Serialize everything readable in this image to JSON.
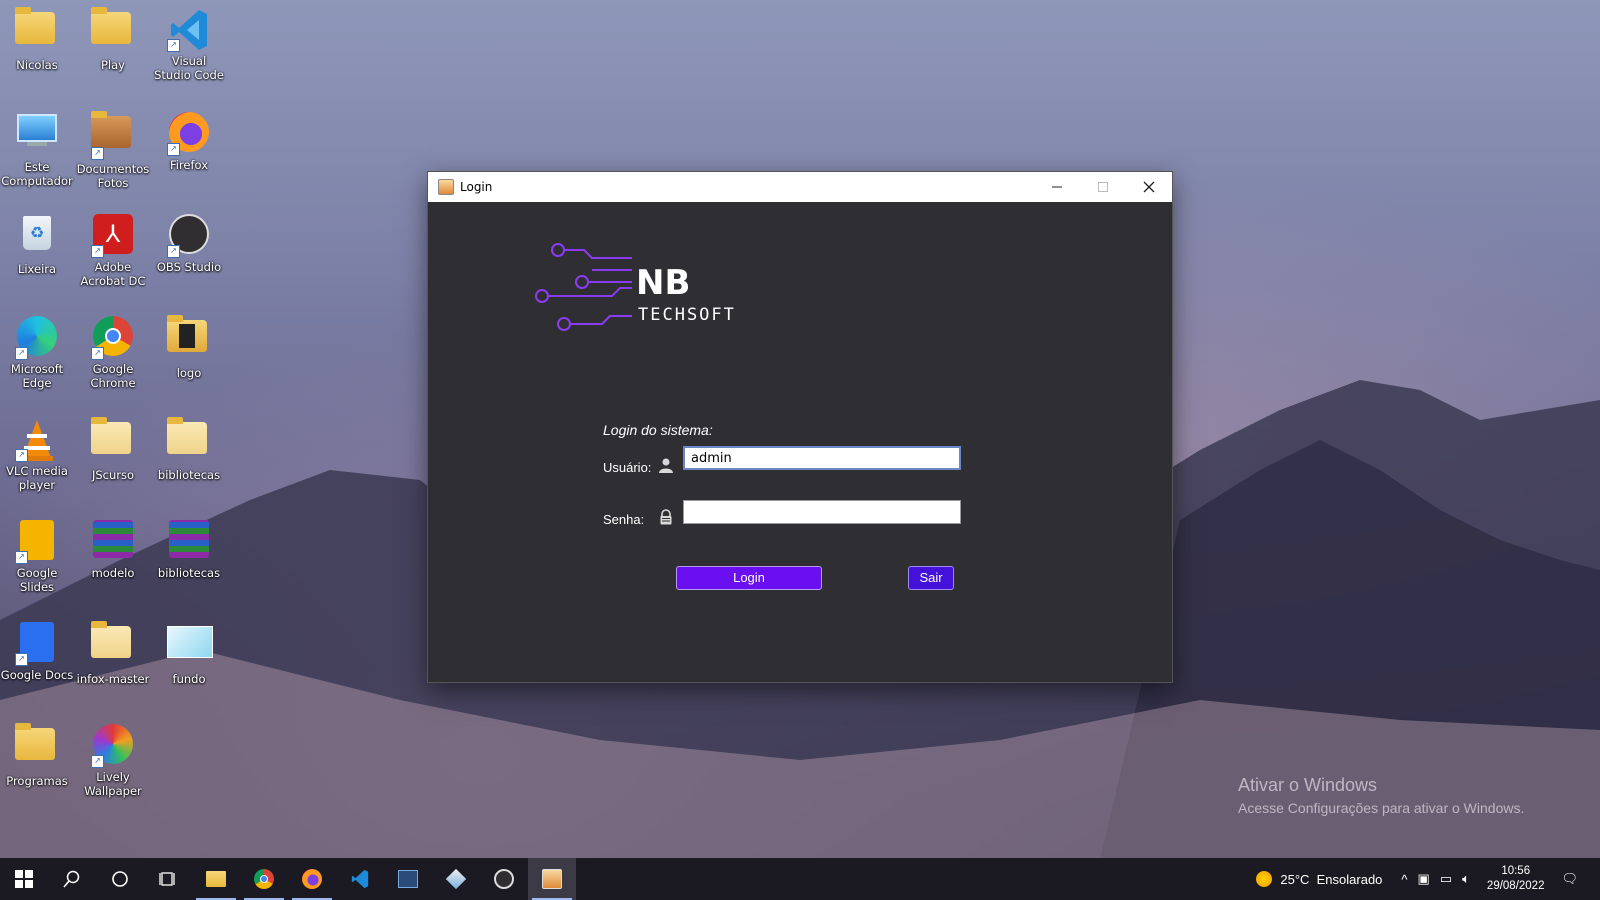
{
  "desktop": {
    "icons": [
      {
        "label": "Nicolas"
      },
      {
        "label": "Play"
      },
      {
        "label": "Visual Studio Code"
      },
      {
        "label": "Este Computador"
      },
      {
        "label": "Documentos Fotos"
      },
      {
        "label": "Firefox"
      },
      {
        "label": "Lixeira"
      },
      {
        "label": "Adobe Acrobat DC"
      },
      {
        "label": "OBS Studio"
      },
      {
        "label": "Microsoft Edge"
      },
      {
        "label": "Google Chrome"
      },
      {
        "label": "logo"
      },
      {
        "label": "VLC media player"
      },
      {
        "label": "JScurso"
      },
      {
        "label": "bibliotecas"
      },
      {
        "label": "Google Slides"
      },
      {
        "label": "modelo"
      },
      {
        "label": "bibliotecas"
      },
      {
        "label": "Google Docs"
      },
      {
        "label": "infox-master"
      },
      {
        "label": "fundo"
      },
      {
        "label": "Programas"
      },
      {
        "label": "Lively Wallpaper"
      }
    ]
  },
  "window": {
    "title": "Login",
    "logo": {
      "line1": "NB",
      "line2": "TECHSOFT"
    },
    "heading": "Login do sistema:",
    "user_label": "Usuário:",
    "user_value": "admin",
    "pass_label": "Senha:",
    "pass_value": "",
    "login_button": "Login",
    "exit_button": "Sair"
  },
  "watermark": {
    "title": "Ativar o Windows",
    "subtitle": "Acesse Configurações para ativar o Windows."
  },
  "taskbar": {
    "weather": "25°C  Ensolarado",
    "time": "10:56",
    "date": "29/08/2022"
  },
  "colors": {
    "window_bg": "#2f2f33",
    "accent_purple": "#6a10f0",
    "logo_purple": "#8a3cf5"
  }
}
